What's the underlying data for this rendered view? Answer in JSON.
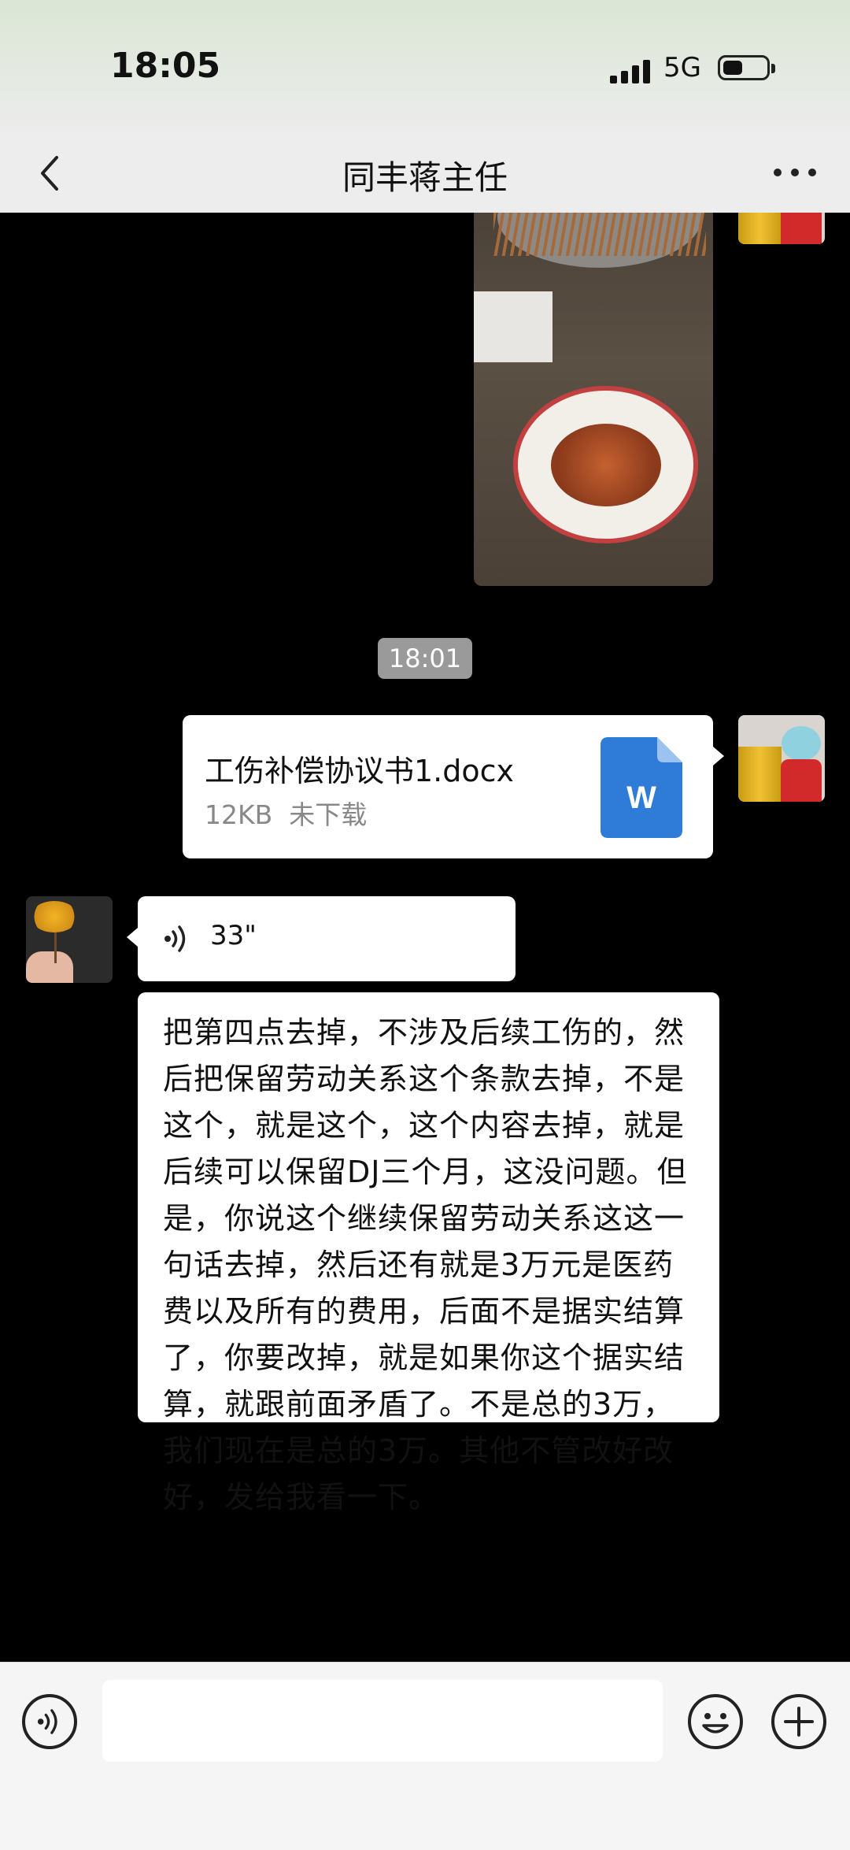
{
  "status": {
    "time": "18:05",
    "network": "5G"
  },
  "header": {
    "title": "同丰蒋主任"
  },
  "messages": {
    "timestamp": "18:01",
    "file": {
      "name": "工伤补偿协议书1.docx",
      "size": "12KB",
      "status": "未下载",
      "icon_letter": "W"
    },
    "voice": {
      "duration": "33\""
    },
    "text": "把第四点去掉，不涉及后续工伤的，然后把保留劳动关系这个条款去掉，不是这个，就是这个，这个内容去掉，就是后续可以保留DJ三个月，这没问题。但是，你说这个继续保留劳动关系这这一句话去掉，然后还有就是3万元是医药费以及所有的费用，后面不是据实结算了，你要改掉，就是如果你这个据实结算，就跟前面矛盾了。不是总的3万，我们现在是总的3万。其他不管改好改好，发给我看一下。"
  },
  "input": {
    "value": ""
  },
  "colors": {
    "word_blue": "#2f7bd8",
    "bubble": "#ffffff",
    "chat_bg": "#000000"
  }
}
